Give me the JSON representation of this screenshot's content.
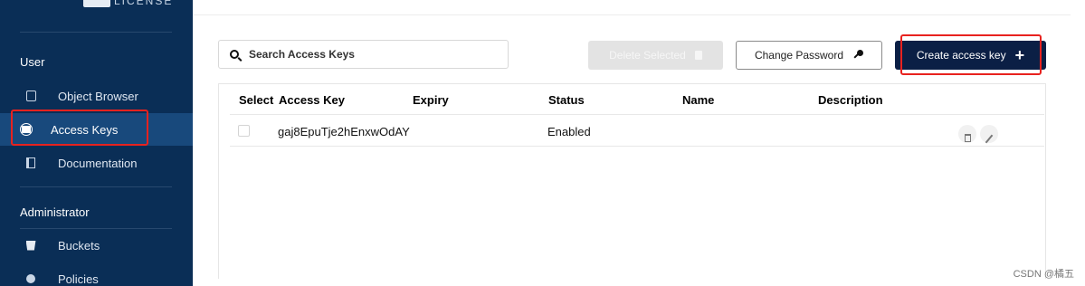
{
  "sidebar": {
    "logo_text": "LICENSE",
    "sections": {
      "user": "User",
      "administrator": "Administrator"
    },
    "items": [
      {
        "label": "Object Browser",
        "icon": "object-browser-icon",
        "active": false
      },
      {
        "label": "Access Keys",
        "icon": "access-keys-icon",
        "active": true
      },
      {
        "label": "Documentation",
        "icon": "documentation-icon",
        "active": false
      },
      {
        "label": "Buckets",
        "icon": "bucket-icon",
        "active": false
      },
      {
        "label": "Policies",
        "icon": "policy-icon",
        "active": false
      }
    ],
    "colors": {
      "background": "#0a2e56",
      "active": "#18497c"
    }
  },
  "toolbar": {
    "search_placeholder": "Search Access Keys",
    "delete_label": "Delete Selected",
    "change_password_label": "Change Password",
    "create_label": "Create access key"
  },
  "table": {
    "columns": [
      "Select",
      "Access Key",
      "Expiry",
      "Status",
      "Name",
      "Description"
    ],
    "rows": [
      {
        "access_key": "gaj8EpuTje2hEnxwOdAY",
        "expiry": "",
        "status": "Enabled",
        "name": "",
        "description": ""
      }
    ]
  },
  "highlight_color": "#e8221f",
  "watermark": "CSDN @橘五"
}
